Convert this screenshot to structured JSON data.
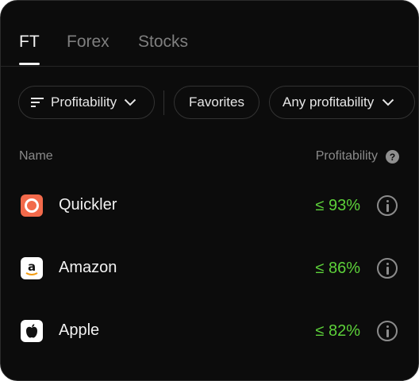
{
  "tabs": [
    {
      "label": "FT"
    },
    {
      "label": "Forex"
    },
    {
      "label": "Stocks"
    }
  ],
  "filters": {
    "sort_label": "Profitability",
    "favorites_label": "Favorites",
    "profit_filter_label": "Any profitability"
  },
  "columns": {
    "name": "Name",
    "profitability": "Profitability",
    "help_glyph": "?"
  },
  "assets": [
    {
      "name": "Quickler",
      "profit": "≤ 93%",
      "icon": "quickler-logo-icon"
    },
    {
      "name": "Amazon",
      "profit": "≤ 86%",
      "icon": "amazon-logo-icon"
    },
    {
      "name": "Apple",
      "profit": "≤ 82%",
      "icon": "apple-logo-icon"
    }
  ],
  "colors": {
    "background": "#0c0c0c",
    "profit_green": "#5dd23a",
    "quickler_orange": "#f26a4b"
  }
}
